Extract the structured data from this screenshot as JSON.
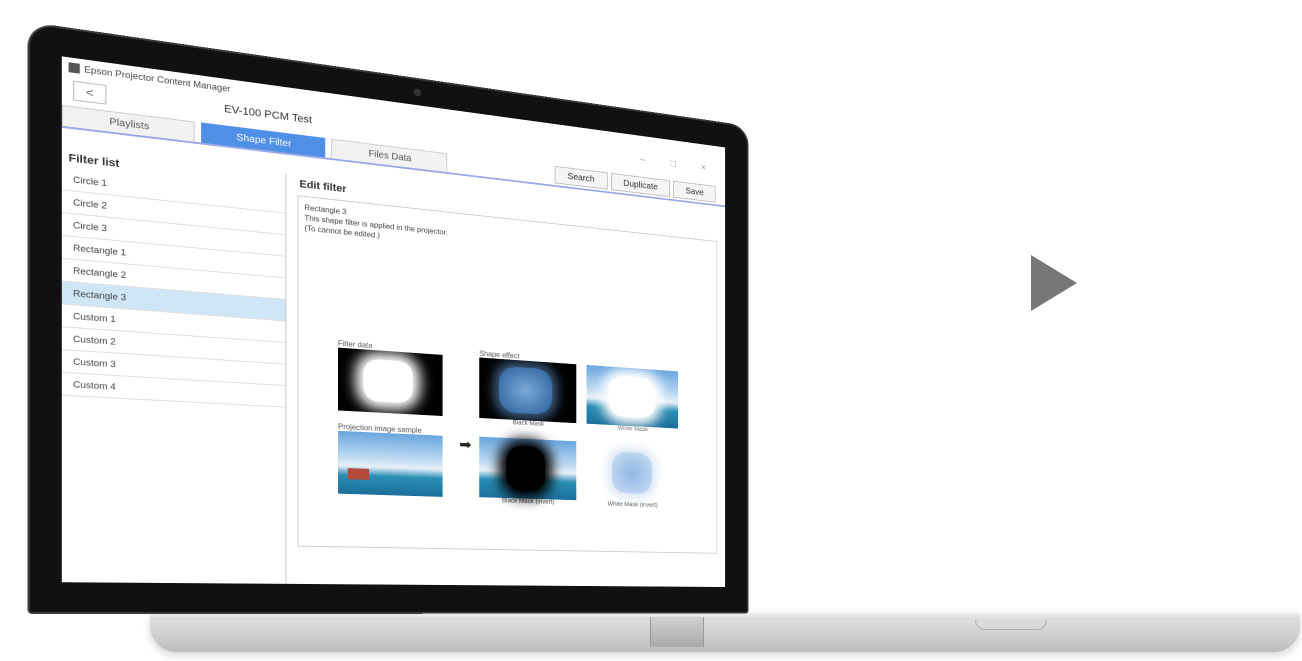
{
  "window": {
    "app_title": "Epson Projector Content Manager",
    "back_label": "<",
    "file_title": "EV-100 PCM Test",
    "controls": "– □ ×"
  },
  "tabs": [
    {
      "label": "Playlists"
    },
    {
      "label": "Shape Filter"
    },
    {
      "label": "Files Data"
    }
  ],
  "toolbar": {
    "search_label": "Search",
    "duplicate_label": "Duplicate",
    "save_label": "Save"
  },
  "filter_list": {
    "title": "Filter list",
    "items": [
      "Circle 1",
      "Circle 2",
      "Circle 3",
      "Rectangle 1",
      "Rectangle 2",
      "Rectangle 3",
      "Custom 1",
      "Custom 2",
      "Custom 3",
      "Custom 4"
    ],
    "selected_index": 5
  },
  "edit_filter": {
    "title": "Edit filter",
    "name": "Rectangle 3",
    "desc_line1": "This shape filter is applied in the projector.",
    "desc_line2": "(To cannot be edited.)",
    "filter_data_label": "Filter data",
    "projection_sample_label": "Projection image sample",
    "shape_effect_label": "Shape effect",
    "captions": {
      "black_mask": "Black Mask",
      "white_mask": "White Mask",
      "black_mask_invert": "Black Mask (invert)",
      "white_mask_invert": "White Mask (invert)"
    },
    "arrow": "➡"
  },
  "colors": {
    "accent": "#4f8fe6",
    "selected_row": "#cfe6f7",
    "next_arrow": "#777777"
  },
  "icons": {
    "next": "play-triangle"
  }
}
